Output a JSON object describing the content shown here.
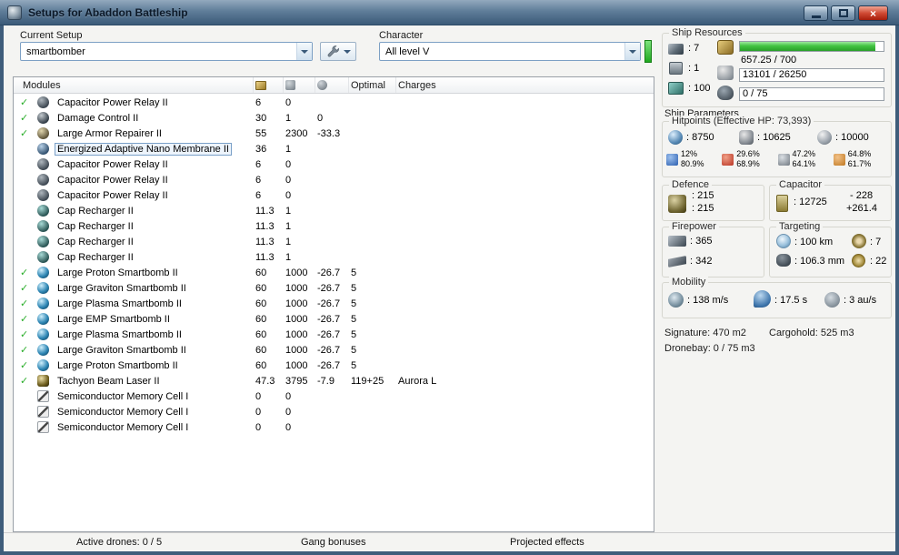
{
  "window": {
    "title": "Setups for Abaddon Battleship",
    "close_glyph": "×"
  },
  "toolbar": {
    "current_setup_label": "Current Setup",
    "current_setup_value": "smartbomber",
    "character_label": "Character",
    "character_value": "All level V"
  },
  "ship_resources": {
    "title": "Ship Resources",
    "turret_hardpoints": ": 7",
    "launcher_hardpoints": ": 1",
    "calibration": ": 100",
    "cpu_text": "657.25 / 700",
    "cpu_fill_pct": 94,
    "powergrid_text": "13101 / 26250",
    "dronebay_text": "0 / 75"
  },
  "modules_table": {
    "col_modules": "Modules",
    "col_optimal": "Optimal",
    "col_charges": "Charges",
    "check_glyph": "✓",
    "rows": [
      {
        "checked": true,
        "selected": false,
        "icon": "relay",
        "name": "Capacitor Power Relay II",
        "cpu": "6",
        "pg": "0",
        "cap": "",
        "optimal": "",
        "charges": ""
      },
      {
        "checked": true,
        "selected": false,
        "icon": "damage-control",
        "name": "Damage Control II",
        "cpu": "30",
        "pg": "1",
        "cap": "0",
        "optimal": "",
        "charges": ""
      },
      {
        "checked": true,
        "selected": false,
        "icon": "armor-repairer",
        "name": "Large Armor Repairer II",
        "cpu": "55",
        "pg": "2300",
        "cap": "-33.3",
        "optimal": "",
        "charges": ""
      },
      {
        "checked": false,
        "selected": true,
        "icon": "membrane",
        "name": "Energized Adaptive Nano Membrane II",
        "cpu": "36",
        "pg": "1",
        "cap": "",
        "optimal": "",
        "charges": ""
      },
      {
        "checked": false,
        "selected": false,
        "icon": "relay",
        "name": "Capacitor Power Relay II",
        "cpu": "6",
        "pg": "0",
        "cap": "",
        "optimal": "",
        "charges": ""
      },
      {
        "checked": false,
        "selected": false,
        "icon": "relay",
        "name": "Capacitor Power Relay II",
        "cpu": "6",
        "pg": "0",
        "cap": "",
        "optimal": "",
        "charges": ""
      },
      {
        "checked": false,
        "selected": false,
        "icon": "relay",
        "name": "Capacitor Power Relay II",
        "cpu": "6",
        "pg": "0",
        "cap": "",
        "optimal": "",
        "charges": ""
      },
      {
        "checked": false,
        "selected": false,
        "icon": "recharger",
        "name": "Cap Recharger II",
        "cpu": "11.3",
        "pg": "1",
        "cap": "",
        "optimal": "",
        "charges": ""
      },
      {
        "checked": false,
        "selected": false,
        "icon": "recharger",
        "name": "Cap Recharger II",
        "cpu": "11.3",
        "pg": "1",
        "cap": "",
        "optimal": "",
        "charges": ""
      },
      {
        "checked": false,
        "selected": false,
        "icon": "recharger",
        "name": "Cap Recharger II",
        "cpu": "11.3",
        "pg": "1",
        "cap": "",
        "optimal": "",
        "charges": ""
      },
      {
        "checked": false,
        "selected": false,
        "icon": "recharger",
        "name": "Cap Recharger II",
        "cpu": "11.3",
        "pg": "1",
        "cap": "",
        "optimal": "",
        "charges": ""
      },
      {
        "checked": true,
        "selected": false,
        "icon": "smartbomb",
        "name": "Large Proton Smartbomb II",
        "cpu": "60",
        "pg": "1000",
        "cap": "-26.7",
        "optimal": "5",
        "charges": ""
      },
      {
        "checked": true,
        "selected": false,
        "icon": "smartbomb",
        "name": "Large Graviton Smartbomb II",
        "cpu": "60",
        "pg": "1000",
        "cap": "-26.7",
        "optimal": "5",
        "charges": ""
      },
      {
        "checked": true,
        "selected": false,
        "icon": "smartbomb",
        "name": "Large Plasma Smartbomb II",
        "cpu": "60",
        "pg": "1000",
        "cap": "-26.7",
        "optimal": "5",
        "charges": ""
      },
      {
        "checked": true,
        "selected": false,
        "icon": "smartbomb",
        "name": "Large EMP Smartbomb II",
        "cpu": "60",
        "pg": "1000",
        "cap": "-26.7",
        "optimal": "5",
        "charges": ""
      },
      {
        "checked": true,
        "selected": false,
        "icon": "smartbomb",
        "name": "Large Plasma Smartbomb II",
        "cpu": "60",
        "pg": "1000",
        "cap": "-26.7",
        "optimal": "5",
        "charges": ""
      },
      {
        "checked": true,
        "selected": false,
        "icon": "smartbomb",
        "name": "Large Graviton Smartbomb II",
        "cpu": "60",
        "pg": "1000",
        "cap": "-26.7",
        "optimal": "5",
        "charges": ""
      },
      {
        "checked": true,
        "selected": false,
        "icon": "smartbomb",
        "name": "Large Proton Smartbomb II",
        "cpu": "60",
        "pg": "1000",
        "cap": "-26.7",
        "optimal": "5",
        "charges": ""
      },
      {
        "checked": true,
        "selected": false,
        "icon": "laser",
        "name": "Tachyon Beam Laser II",
        "cpu": "47.3",
        "pg": "3795",
        "cap": "-7.9",
        "optimal": "119+25",
        "charges": "Aurora L"
      },
      {
        "checked": false,
        "selected": false,
        "icon": "semiconductor",
        "name": "Semiconductor Memory Cell I",
        "cpu": "0",
        "pg": "0",
        "cap": "",
        "optimal": "",
        "charges": ""
      },
      {
        "checked": false,
        "selected": false,
        "icon": "semiconductor",
        "name": "Semiconductor Memory Cell I",
        "cpu": "0",
        "pg": "0",
        "cap": "",
        "optimal": "",
        "charges": ""
      },
      {
        "checked": false,
        "selected": false,
        "icon": "semiconductor",
        "name": "Semiconductor Memory Cell I",
        "cpu": "0",
        "pg": "0",
        "cap": "",
        "optimal": "",
        "charges": ""
      }
    ]
  },
  "ship_parameters": {
    "title": "Ship Parameters",
    "hitpoints": {
      "title": "Hitpoints (Effective HP: 73,393)",
      "shield": ": 8750",
      "armor": ": 10625",
      "hull": ": 10000",
      "resists": [
        {
          "type": "em",
          "shield": "12%",
          "armor": "80.9%"
        },
        {
          "type": "thermal",
          "shield": "29.6%",
          "armor": "68.9%"
        },
        {
          "type": "kinetic",
          "shield": "47.2%",
          "armor": "64.1%"
        },
        {
          "type": "explosive",
          "shield": "64.8%",
          "armor": "61.7%"
        }
      ]
    },
    "defence": {
      "title": "Defence",
      "top": ": 215",
      "bottom": ": 215"
    },
    "capacitor": {
      "title": "Capacitor",
      "amount": ": 12725",
      "drain": "- 228",
      "recharge": "+261.4"
    },
    "firepower": {
      "title": "Firepower",
      "volley": ": 365",
      "dps": ": 342"
    },
    "targeting": {
      "title": "Targeting",
      "range": ": 100 km",
      "max_targets": ": 7",
      "scan_resolution": ": 106.3 mm",
      "sensor_strength": ": 22"
    },
    "mobility": {
      "title": "Mobility",
      "speed": ": 138 m/s",
      "align_time": ": 17.5 s",
      "warp_speed": ": 3 au/s"
    },
    "signature": "Signature: 470 m2",
    "cargohold": "Cargohold: 525 m3",
    "dronebay": "Dronebay: 0 / 75 m3"
  },
  "status_bar": {
    "active_drones": "Active drones: 0 / 5",
    "gang_bonuses": "Gang bonuses",
    "projected_effects": "Projected effects"
  },
  "colors": {
    "accent_green": "#2fae2f",
    "titlebar_top": "#93a9bd",
    "titlebar_bottom": "#3b5a78",
    "selection_border": "#7aa0c8"
  }
}
